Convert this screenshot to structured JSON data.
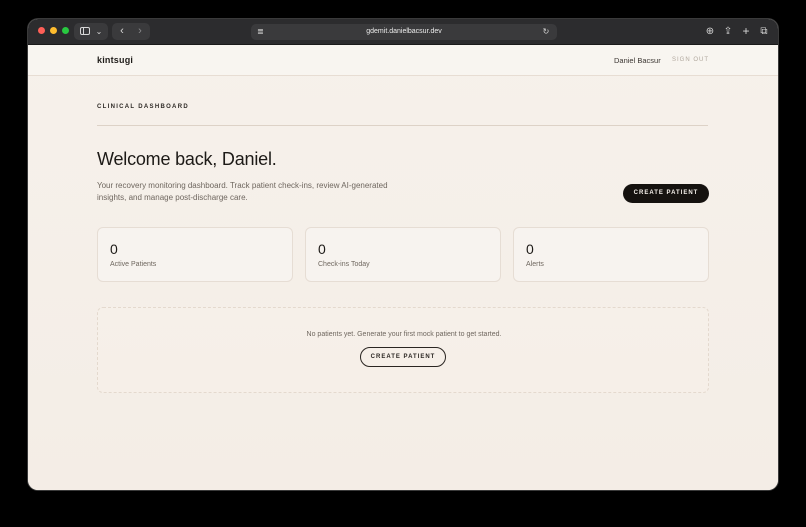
{
  "browser": {
    "url": "gdemit.danielbacsur.dev",
    "icons": {
      "sidebar": "sidebar-icon",
      "back": "chevron-left-icon",
      "forward": "chevron-right-icon",
      "reader": "reader-icon",
      "reload": "reload-icon",
      "download": "download-icon",
      "share": "share-icon",
      "new_tab": "plus-icon",
      "tabs": "tabs-overview-icon"
    }
  },
  "header": {
    "brand": "kintsugi",
    "user_name": "Daniel Bacsur",
    "sign_out_label": "SIGN OUT"
  },
  "main": {
    "section_label": "CLINICAL DASHBOARD",
    "welcome_title": "Welcome back, Daniel.",
    "subtitle": "Your recovery monitoring dashboard. Track patient check-ins, review AI-generated insights, and manage post-discharge care.",
    "create_button_label": "CREATE PATIENT",
    "stats": [
      {
        "value": "0",
        "label": "Active Patients"
      },
      {
        "value": "0",
        "label": "Check-ins Today"
      },
      {
        "value": "0",
        "label": "Alerts"
      }
    ],
    "empty_state": {
      "message": "No patients yet. Generate your first mock patient to get started.",
      "button_label": "CREATE PATIENT"
    }
  },
  "colors": {
    "page_background": "#f5efe9",
    "primary_button": "#15120f",
    "muted_text": "#6f675f",
    "traffic_red": "#ff5f57",
    "traffic_yellow": "#febc2e",
    "traffic_green": "#28c840"
  }
}
